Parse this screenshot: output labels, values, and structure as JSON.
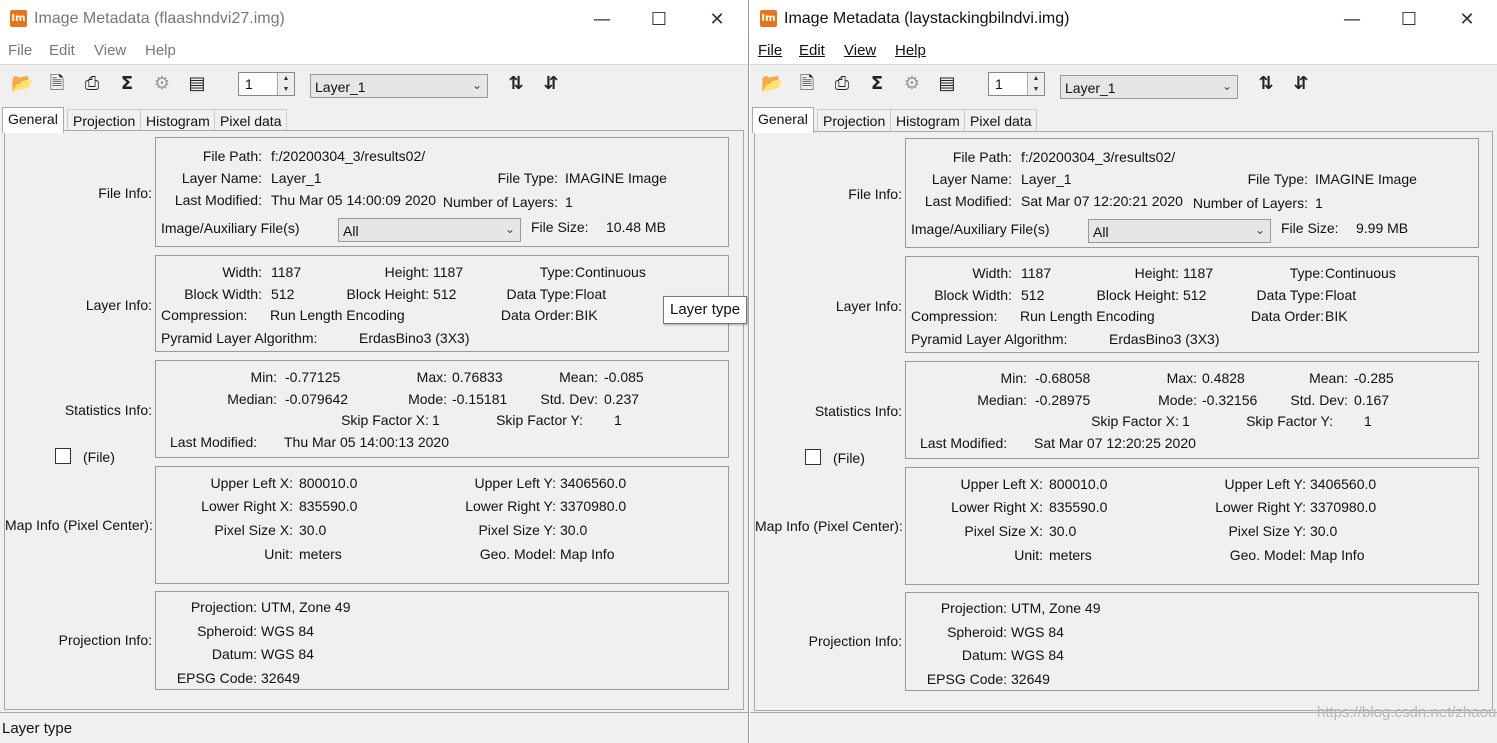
{
  "app_icon_text": "Im",
  "menu": {
    "file": "File",
    "edit": "Edit",
    "view": "View",
    "help": "Help"
  },
  "toolbar": {
    "icons": [
      "open-folder-icon",
      "new-document-icon",
      "print-icon",
      "sum-icon",
      "settings-gear-icon",
      "histogram-icon",
      "sort-ascending-icon",
      "sort-descending-icon"
    ],
    "layer_spin_value": "1",
    "layer_select": "Layer_1"
  },
  "tabs": [
    "General",
    "Projection",
    "Histogram",
    "Pixel data"
  ],
  "labels": {
    "file_info": "File Info:",
    "layer_info": "Layer Info:",
    "statistics_info": "Statistics Info:",
    "map_info": "Map Info (Pixel Center):",
    "projection_info": "Projection Info:",
    "file_checkbox": "(File)",
    "file_path": "File Path:",
    "layer_name": "Layer Name:",
    "last_modified": "Last Modified:",
    "file_type": "File Type:",
    "number_of_layers": "Number of Layers:",
    "aux_files": "Image/Auxiliary File(s)",
    "file_size": "File Size:",
    "width": "Width:",
    "height": "Height:",
    "type": "Type:",
    "block_width": "Block Width:",
    "block_height": "Block Height:",
    "data_type": "Data Type:",
    "compression": "Compression:",
    "data_order": "Data Order:",
    "pyramid": "Pyramid Layer Algorithm:",
    "min": "Min:",
    "max": "Max:",
    "mean": "Mean:",
    "median": "Median:",
    "mode": "Mode:",
    "std_dev": "Std. Dev:",
    "skip_x": "Skip Factor X:",
    "skip_y": "Skip Factor Y:",
    "stats_last_modified": "Last Modified:",
    "upper_left_x": "Upper Left X:",
    "upper_left_y": "Upper Left Y:",
    "lower_right_x": "Lower Right X:",
    "lower_right_y": "Lower Right Y:",
    "pixel_size_x": "Pixel Size X:",
    "pixel_size_y": "Pixel Size Y:",
    "unit": "Unit:",
    "geo_model": "Geo. Model:",
    "projection": "Projection:",
    "spheroid": "Spheroid:",
    "datum": "Datum:",
    "epsg": "EPSG Code:"
  },
  "windows": [
    {
      "title": "Image Metadata (flaashndvi27.img)",
      "file": {
        "path": "f:/20200304_3/results02/",
        "layer_name": "Layer_1",
        "last_modified": "Thu Mar 05 14:00:09 2020",
        "file_type": "IMAGINE Image",
        "number_of_layers": "1",
        "aux_select": "All",
        "file_size": "10.48 MB"
      },
      "layer": {
        "width": "1187",
        "height": "1187",
        "type": "Continuous",
        "block_width": "512",
        "block_height": "512",
        "data_type": "Float",
        "compression": "Run Length Encoding",
        "data_order": "BIK",
        "pyramid": "ErdasBino3 (3X3)"
      },
      "stats": {
        "min": "-0.77125",
        "max": "0.76833",
        "mean": "-0.085",
        "median": "-0.079642",
        "mode": "-0.15181",
        "std_dev": "0.237",
        "skip_x": "1",
        "skip_y": "1",
        "last_modified": "Thu Mar 05 14:00:13 2020"
      },
      "map": {
        "upper_left_x": "800010.0",
        "upper_left_y": "3406560.0",
        "lower_right_x": "835590.0",
        "lower_right_y": "3370980.0",
        "pixel_size_x": "30.0",
        "pixel_size_y": "30.0",
        "unit": "meters",
        "geo_model": "Map Info"
      },
      "proj": {
        "projection": "UTM, Zone 49",
        "spheroid": "WGS 84",
        "datum": "WGS 84",
        "epsg": "32649"
      },
      "status": "Layer type",
      "tooltip": "Layer type"
    },
    {
      "title": "Image Metadata (laystackingbilndvi.img)",
      "file": {
        "path": "f:/20200304_3/results02/",
        "layer_name": "Layer_1",
        "last_modified": "Sat Mar 07 12:20:21 2020",
        "file_type": "IMAGINE Image",
        "number_of_layers": "1",
        "aux_select": "All",
        "file_size": "9.99 MB"
      },
      "layer": {
        "width": "1187",
        "height": "1187",
        "type": "Continuous",
        "block_width": "512",
        "block_height": "512",
        "data_type": "Float",
        "compression": "Run Length Encoding",
        "data_order": "BIK",
        "pyramid": "ErdasBino3 (3X3)"
      },
      "stats": {
        "min": "-0.68058",
        "max": "0.4828",
        "mean": "-0.285",
        "median": "-0.28975",
        "mode": "-0.32156",
        "std_dev": "0.167",
        "skip_x": "1",
        "skip_y": "1",
        "last_modified": "Sat Mar 07 12:20:25 2020"
      },
      "map": {
        "upper_left_x": "800010.0",
        "upper_left_y": "3406560.0",
        "lower_right_x": "835590.0",
        "lower_right_y": "3370980.0",
        "pixel_size_x": "30.0",
        "pixel_size_y": "30.0",
        "unit": "meters",
        "geo_model": "Map Info"
      },
      "proj": {
        "projection": "UTM, Zone 49",
        "spheroid": "WGS 84",
        "datum": "WGS 84",
        "epsg": "32649"
      },
      "watermark": "https://blog.csdn.net/zhaoushibiaoshilu @稀土掘金技术社区"
    }
  ]
}
